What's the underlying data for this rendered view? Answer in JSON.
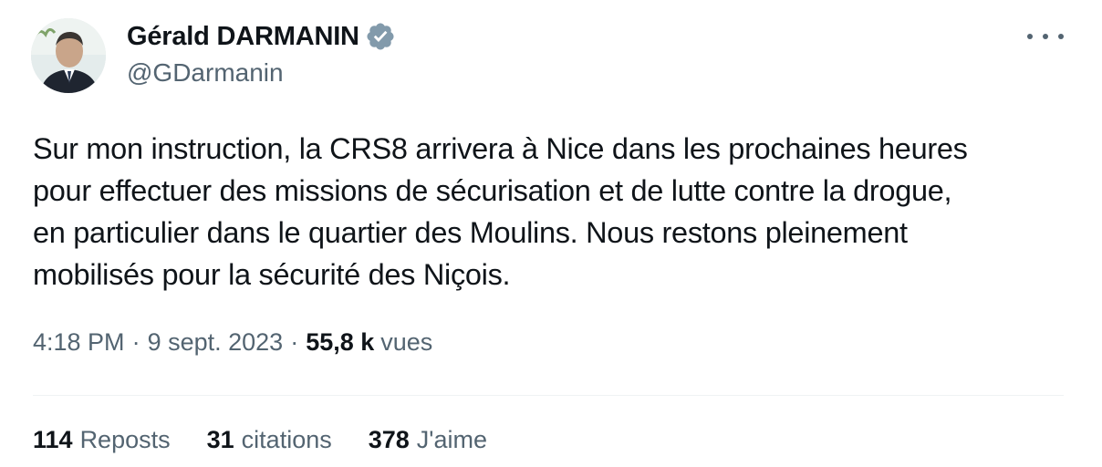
{
  "author": {
    "display_name": "Gérald DARMANIN",
    "handle": "@GDarmanin",
    "verified_icon": "verified-badge-icon",
    "badge_color": "#829aab"
  },
  "menu_icon": "more-options-icon",
  "tweet": {
    "text_lines": [
      "Sur mon instruction, la CRS8 arrivera à Nice dans les prochaines heures",
      "pour effectuer des missions de sécurisation et de lutte contre la drogue,",
      "en particulier dans le quartier des Moulins. Nous restons pleinement",
      "mobilisés pour la sécurité des Niçois."
    ]
  },
  "meta": {
    "time": "4:18 PM",
    "separator": "·",
    "date": "9 sept. 2023",
    "views_count": "55,8 k",
    "views_label": "vues"
  },
  "stats": {
    "reposts_count": "114",
    "reposts_label": "Reposts",
    "quotes_count": "31",
    "quotes_label": "citations",
    "likes_count": "378",
    "likes_label": "J'aime"
  },
  "colors": {
    "text_primary": "#0f1419",
    "text_secondary": "#536471",
    "divider": "#eff3f4"
  }
}
